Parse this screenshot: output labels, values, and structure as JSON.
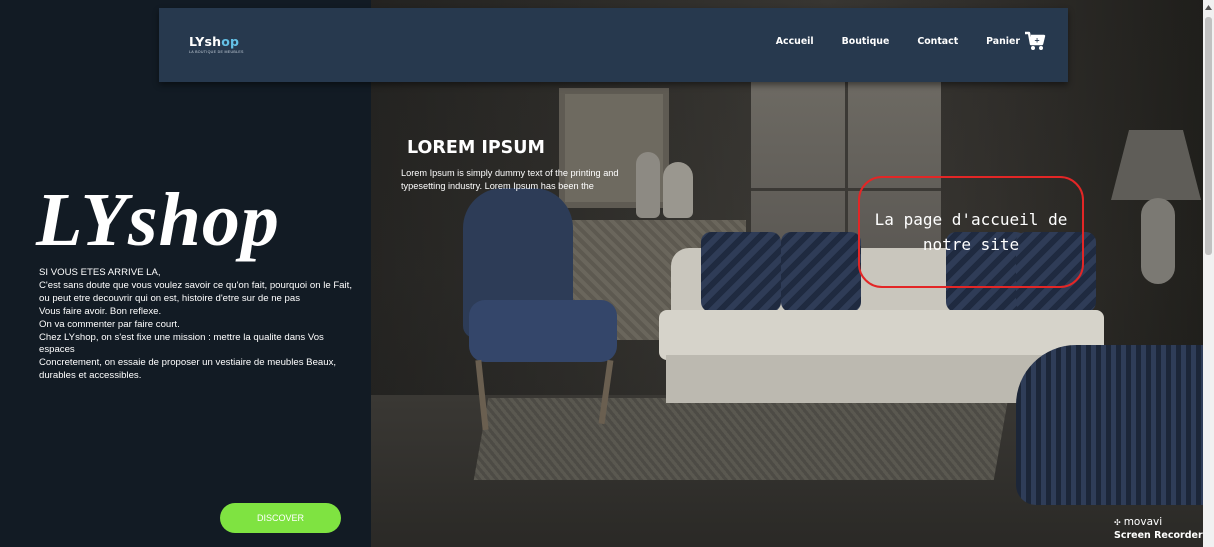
{
  "navbar": {
    "logo": {
      "text_main": "LYsh",
      "text_accent": "op",
      "tagline": "LA BOUTIQUE DE MEUBLES"
    },
    "links": [
      {
        "label": "Accueil"
      },
      {
        "label": "Boutique"
      },
      {
        "label": "Contact"
      }
    ],
    "cart": {
      "label": "Panier",
      "icon": "shopping-cart-icon"
    }
  },
  "left_panel": {
    "brand": "LYshop",
    "intro_lines": [
      "SI VOUS ETES ARRIVE LA,",
      "C'est sans doute que vous voulez savoir ce qu'on fait, pourquoi on le Fait, ou peut etre decouvrir qui on est, histoire d'etre sur de ne pas",
      "Vous faire avoir. Bon reflexe.",
      "On va commenter par faire court.",
      "Chez LYshop, on s'est fixe une mission : mettre la qualite dans Vos espaces",
      "Concretement, on essaie de proposer un vestiaire de meubles Beaux, durables et accessibles."
    ],
    "discover_label": "DISCOVER"
  },
  "hero": {
    "title": "LOREM IPSUM",
    "text": "Lorem Ipsum is simply dummy text of the printing and typesetting industry. Lorem Ipsum has been the"
  },
  "annotation": {
    "text": "La page d'accueil de notre site",
    "border_color": "#e32626"
  },
  "watermark": {
    "brand": "movavi",
    "product": "Screen Recorder"
  },
  "colors": {
    "navbar": "#27394e",
    "left_panel": "#121b24",
    "discover_button": "#7fe341",
    "logo_accent": "#64c1e6"
  }
}
